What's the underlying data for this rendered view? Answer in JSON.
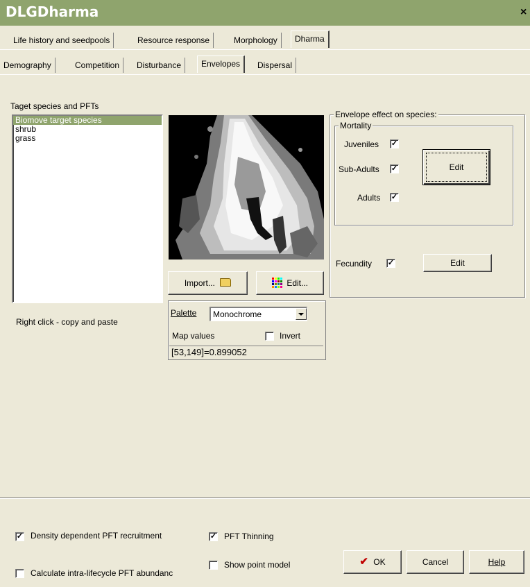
{
  "window": {
    "title": "DLGDharma",
    "close_glyph": "×"
  },
  "tabs_row1": [
    "Life history and seedpools",
    "Resource response",
    "Morphology",
    "Dharma"
  ],
  "tabs_row2": [
    "Demography",
    "Competition",
    "Disturbance",
    "Envelopes",
    "Dispersal"
  ],
  "target_list": {
    "label": "Taget species and PFTs",
    "items": [
      "Biomove target species",
      "shrub",
      "grass"
    ],
    "selected_index": 0,
    "hint": "Right click - copy and paste"
  },
  "map": {
    "import_label": "Import...",
    "edit_label": "Edit...",
    "palette_label": "Palette",
    "palette_value": "Monochrome",
    "map_values_label": "Map values",
    "invert_label": "Invert",
    "invert_checked": false,
    "coordinate_readout": "[53,149]=0.899052"
  },
  "envelope": {
    "group_label": "Envelope effect on species:",
    "mortality_label": "Mortality",
    "juveniles_label": "Juveniles",
    "juveniles_checked": true,
    "subadults_label": "Sub-Adults",
    "subadults_checked": true,
    "adults_label": "Adults",
    "adults_checked": true,
    "mortality_edit_label": "Edit",
    "fecundity_label": "Fecundity",
    "fecundity_checked": true,
    "fecundity_edit_label": "Edit"
  },
  "footer": {
    "density_label": "Density dependent PFT recruitment",
    "density_checked": true,
    "thinning_label": "PFT Thinning",
    "thinning_checked": true,
    "calc_label": "Calculate intra-lifecycle PFT abundanc",
    "calc_checked": false,
    "point_model_label": "Show point model",
    "point_model_checked": false,
    "ok_label": "OK",
    "cancel_label": "Cancel",
    "help_label": "Help"
  },
  "colors": {
    "titlebar": "#8fa46d",
    "face": "#ece9d8",
    "selection": "#8fa46d"
  }
}
